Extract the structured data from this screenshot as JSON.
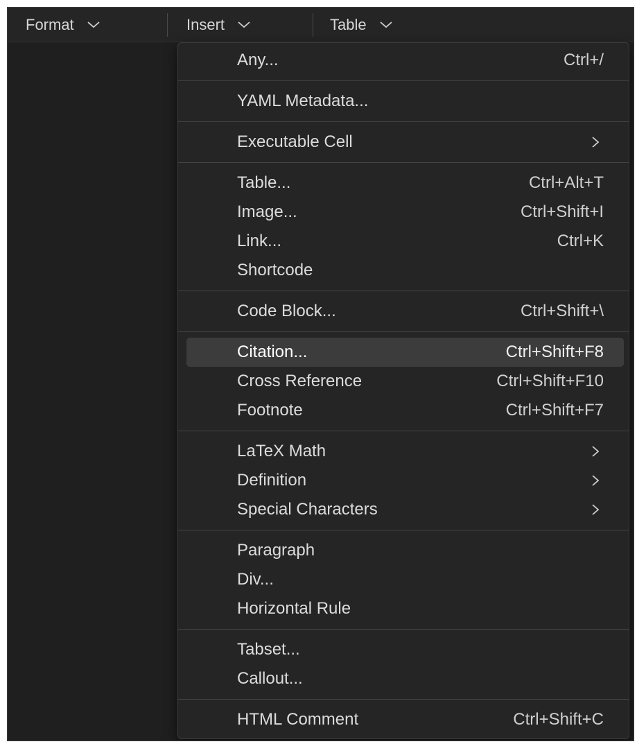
{
  "toolbar": {
    "format_label": "Format",
    "insert_label": "Insert",
    "table_label": "Table"
  },
  "menu": {
    "any": {
      "label": "Any...",
      "shortcut": "Ctrl+/"
    },
    "yaml": {
      "label": "YAML Metadata..."
    },
    "executable_cell": {
      "label": "Executable Cell",
      "submenu_icon": "chevron-right-icon"
    },
    "table": {
      "label": "Table...",
      "shortcut": "Ctrl+Alt+T"
    },
    "image": {
      "label": "Image...",
      "shortcut": "Ctrl+Shift+I"
    },
    "link": {
      "label": "Link...",
      "shortcut": "Ctrl+K"
    },
    "shortcode": {
      "label": "Shortcode"
    },
    "code_block": {
      "label": "Code Block...",
      "shortcut": "Ctrl+Shift+\\"
    },
    "citation": {
      "label": "Citation...",
      "shortcut": "Ctrl+Shift+F8"
    },
    "cross_reference": {
      "label": "Cross Reference",
      "shortcut": "Ctrl+Shift+F10"
    },
    "footnote": {
      "label": "Footnote",
      "shortcut": "Ctrl+Shift+F7"
    },
    "latex_math": {
      "label": "LaTeX Math",
      "submenu_icon": "chevron-right-icon"
    },
    "definition": {
      "label": "Definition",
      "submenu_icon": "chevron-right-icon"
    },
    "special_characters": {
      "label": "Special Characters",
      "submenu_icon": "chevron-right-icon"
    },
    "paragraph": {
      "label": "Paragraph"
    },
    "div": {
      "label": "Div..."
    },
    "horizontal_rule": {
      "label": "Horizontal Rule"
    },
    "tabset": {
      "label": "Tabset..."
    },
    "callout": {
      "label": "Callout..."
    },
    "html_comment": {
      "label": "HTML Comment",
      "shortcut": "Ctrl+Shift+C"
    }
  },
  "colors": {
    "background": "#1f1f1f",
    "menu_background": "#252526",
    "active_item": "#3c3c3c",
    "text": "#dcdcdc"
  }
}
